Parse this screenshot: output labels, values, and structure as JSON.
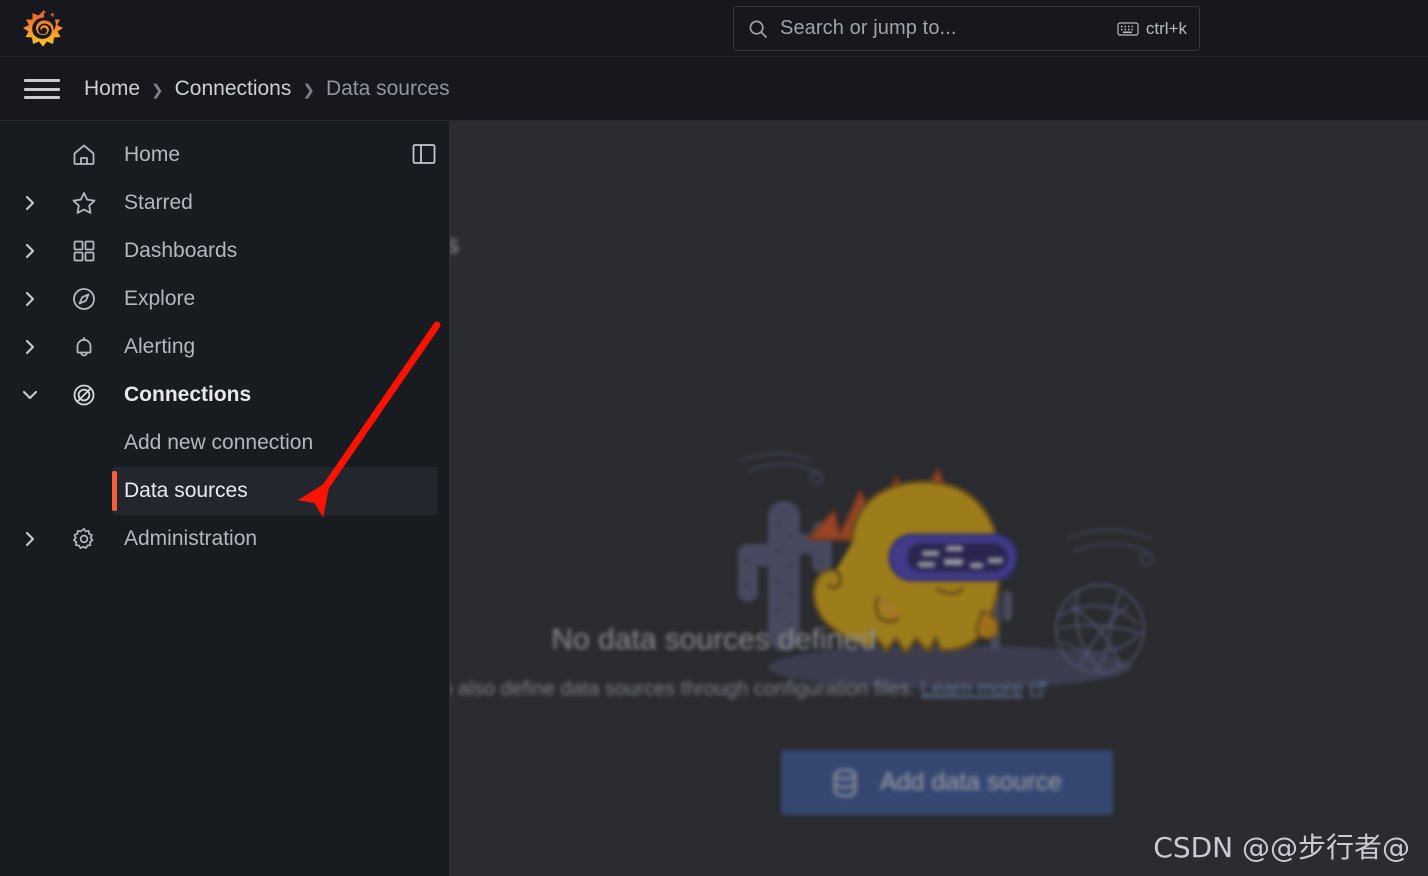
{
  "app": {
    "brand_logo": "grafana-logo",
    "accent_orange": "#f55f3e",
    "primary_blue": "#3d5a9c",
    "sidebar_bg": "#181b1f",
    "content_bg": "#2a2c2f"
  },
  "topbar": {
    "menu_icon": "hamburger-menu-icon",
    "search": {
      "icon": "search-icon",
      "placeholder": "Search or jump to...",
      "value": "",
      "shortcut_icon": "keyboard-icon",
      "shortcut": "ctrl+k"
    }
  },
  "breadcrumb": {
    "separator": "›",
    "items": [
      {
        "label": "Home",
        "current": false
      },
      {
        "label": "Connections",
        "current": false
      },
      {
        "label": "Data sources",
        "current": true
      }
    ]
  },
  "sidebar": {
    "dock_icon": "dock-panel-icon",
    "items": [
      {
        "label": "Home",
        "icon": "home-icon",
        "chevron": "none",
        "expandable": false
      },
      {
        "label": "Starred",
        "icon": "star-icon",
        "chevron": "right",
        "expandable": true
      },
      {
        "label": "Dashboards",
        "icon": "dashboards-grid-icon",
        "chevron": "right",
        "expandable": true
      },
      {
        "label": "Explore",
        "icon": "compass-icon",
        "chevron": "right",
        "expandable": true
      },
      {
        "label": "Alerting",
        "icon": "bell-icon",
        "chevron": "right",
        "expandable": true
      },
      {
        "label": "Connections",
        "icon": "connections-icon",
        "chevron": "down",
        "expandable": true
      }
    ],
    "connections_children": [
      {
        "label": "Add new connection",
        "active": false
      },
      {
        "label": "Data sources",
        "active": true
      }
    ],
    "trailing_items": [
      {
        "label": "Administration",
        "icon": "gear-icon",
        "chevron": "right",
        "expandable": true
      }
    ]
  },
  "main": {
    "heading": "Data source connections",
    "illustration": "grafana-mascot-desert-illustration",
    "empty_state": {
      "title": "No data sources defined",
      "description": "You can also define data sources through configuration files.",
      "link_label": "Learn more",
      "link_icon": "external-link-icon"
    },
    "primary_button": {
      "label": "Add data source",
      "icon": "database-icon"
    }
  },
  "annotation": {
    "type": "red-arrow",
    "color": "#fb1200",
    "points_to": "Data sources"
  },
  "watermark": {
    "text": "CSDN @@步行者@"
  }
}
